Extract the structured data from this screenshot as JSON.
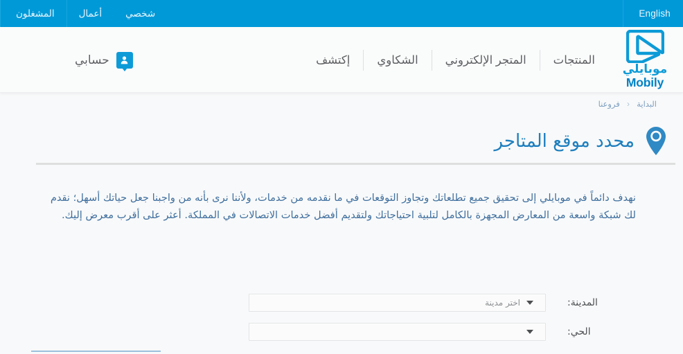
{
  "topbar": {
    "language_button": "English",
    "nav_items": [
      {
        "label": "شخصي",
        "name": "topnav-personal"
      },
      {
        "label": "أعمال",
        "name": "topnav-business"
      },
      {
        "label": "المشغلون",
        "name": "topnav-operators"
      }
    ],
    "background_color": "#0099d8"
  },
  "header": {
    "logo": {
      "arabic": "موبايلي",
      "english": "Mobily",
      "color": "#0d9bd7"
    },
    "nav_items": [
      {
        "label": "المنتجات",
        "name": "nav-products"
      },
      {
        "label": "المتجر الإلكتروني",
        "name": "nav-online-store"
      },
      {
        "label": "الشكاوي",
        "name": "nav-complaints"
      },
      {
        "label": "إكتشف",
        "name": "nav-discover"
      }
    ],
    "account": {
      "label": "حسابي",
      "icon": "user-badge-icon"
    }
  },
  "breadcrumb": {
    "items": [
      {
        "label": "البداية",
        "name": "breadcrumb-home"
      },
      {
        "label": "فروعنا",
        "name": "breadcrumb-our-branches"
      }
    ],
    "separator": "‹"
  },
  "page": {
    "title": "محدد موقع المتاجر",
    "title_icon": "map-pin-icon",
    "title_color": "#1e7fbe",
    "intro": "نهدف دائماً في موبايلي إلى تحقيق جميع تطلعاتك وتجاوز التوقعات في ما نقدمه من خدمات، ولأننا نرى بأنه من واجبنا جعل حياتك أسهل؛ نقدم لك شبكة واسعة من المعارض المجهزة بالكامل لتلبية احتياجاتك ولتقديم أفضل خدمات الاتصالات في المملكة. أعثر على أقرب معرض إليك."
  },
  "form": {
    "fields": [
      {
        "label": "المدينة:",
        "value": "اختر مدينة",
        "name": "city-select",
        "has_value": true
      },
      {
        "label": "الحي:",
        "value": "",
        "name": "district-select",
        "has_value": false
      }
    ]
  },
  "colors": {
    "brand_blue": "#0099d8",
    "logo_blue": "#0d9bd7",
    "title_blue": "#1e7fbe",
    "body_text": "#3f6f9e",
    "nav_text": "#5e6063",
    "page_bg": "#f8f9fa"
  }
}
